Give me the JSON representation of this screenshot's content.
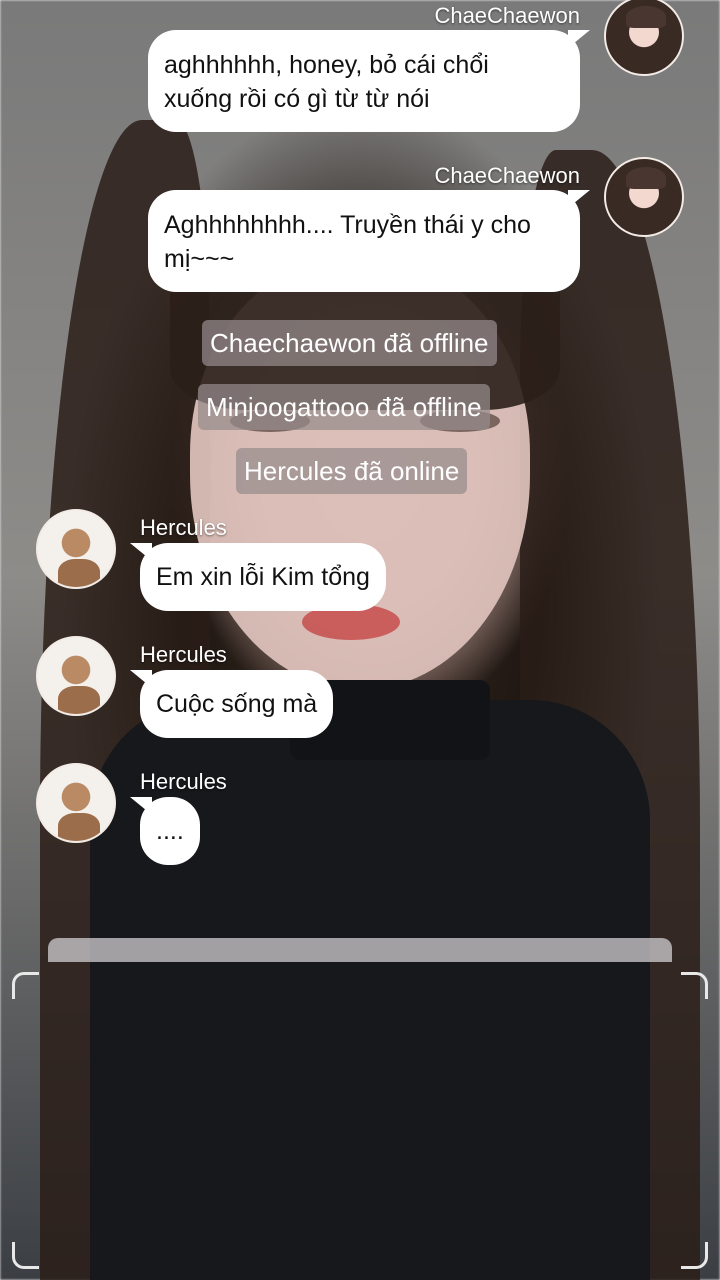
{
  "messages": [
    {
      "sender": "ChaeChaewon",
      "text_line1": "aghhhhhh, honey, bỏ cái chổi",
      "text_line2": "xuống rồi có gì từ từ nói"
    },
    {
      "sender": "ChaeChaewon",
      "text_line1": "Aghhhhhhhh.... Truyền thái y cho",
      "text_line2": "mị~~~"
    },
    {
      "sender": "Hercules",
      "text": "Em xin lỗi Kim tổng"
    },
    {
      "sender": "Hercules",
      "text": "Cuộc sống mà"
    },
    {
      "sender": "Hercules",
      "text": "...."
    }
  ],
  "system_notices": [
    "Chaechaewon đã offline",
    "Minjoogattooo đã offline",
    "Hercules đã online"
  ]
}
